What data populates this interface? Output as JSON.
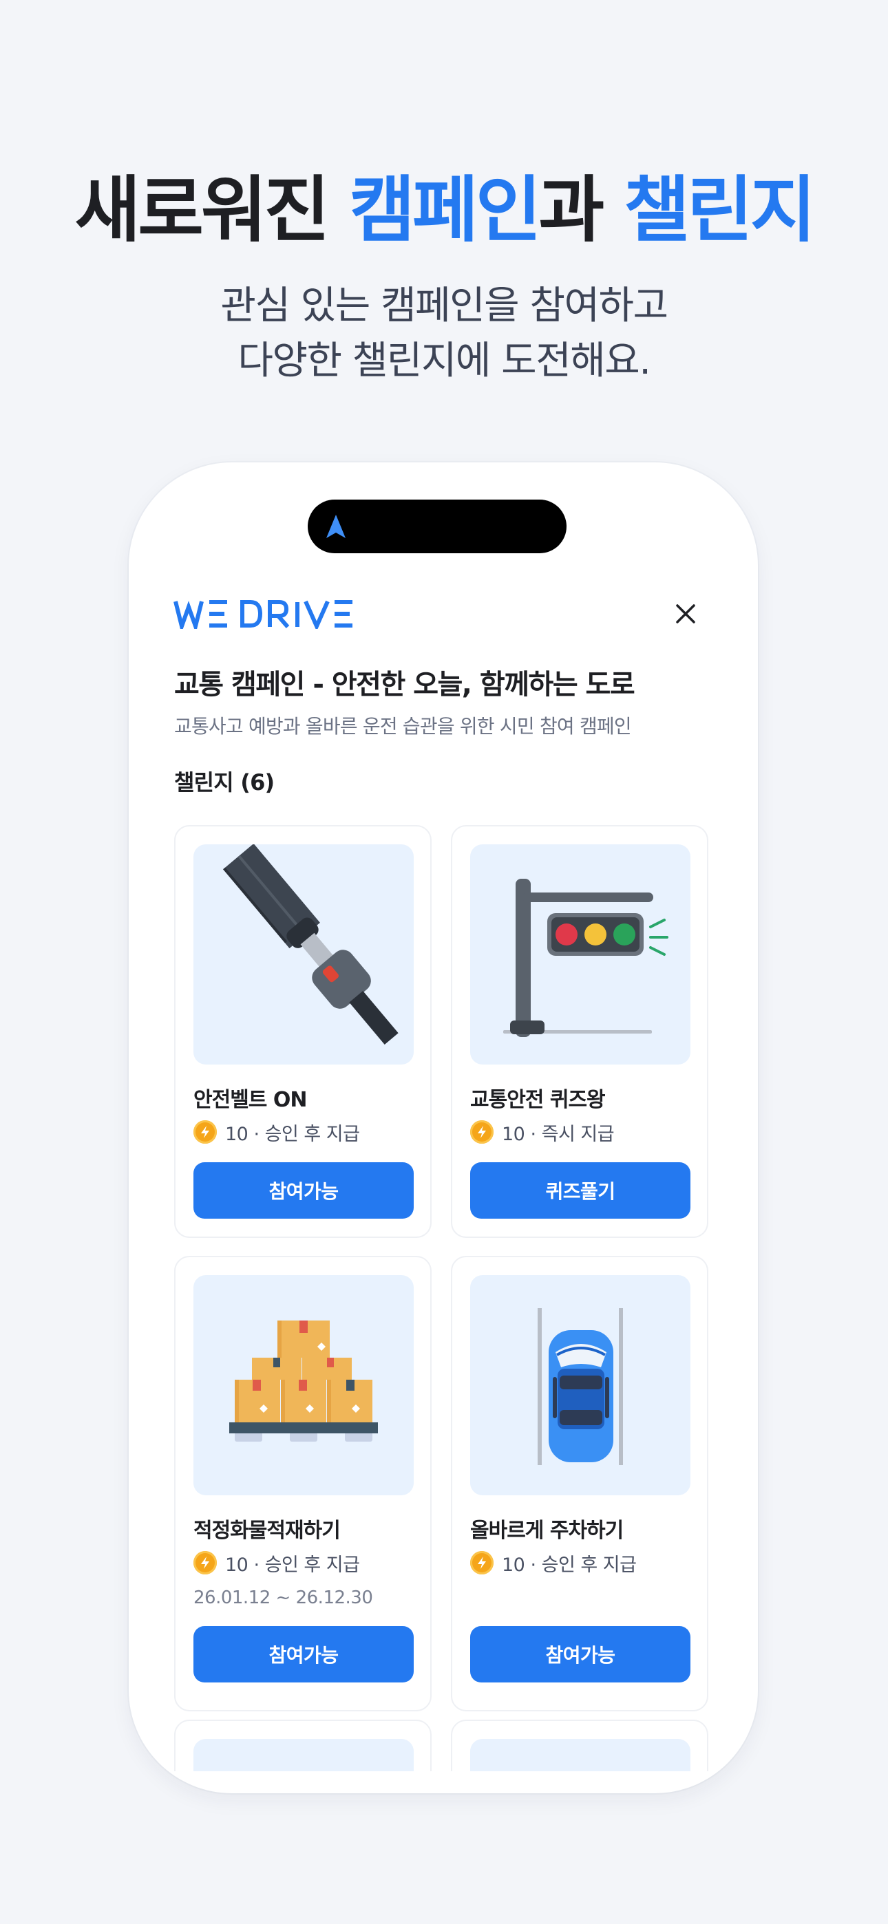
{
  "promo": {
    "headline_part1": "새로워진 ",
    "headline_accent1": "캠페인",
    "headline_part2": "과 ",
    "headline_accent2": "챌린지",
    "subhead_line1": "관심 있는 캠페인을 참여하고",
    "subhead_line2": "다양한 챌린지에 도전해요."
  },
  "app": {
    "logo": "WE DRIVE",
    "close_icon": "close-icon",
    "campaign_title": "교통 캠페인 - 안전한 오늘, 함께하는 도로",
    "campaign_description": "교통사고 예방과 올바른 운전 습관을 위한 시민 참여 캠페인",
    "challenge_section_label": "챌린지 (6)",
    "challenges": [
      {
        "name": "안전벨트 ON",
        "image_icon": "seatbelt-icon",
        "reward": "10 · 승인 후 지급",
        "period": "",
        "button_label": "참여가능"
      },
      {
        "name": "교통안전 퀴즈왕",
        "image_icon": "traffic-light-icon",
        "reward": "10 · 즉시 지급",
        "period": "",
        "button_label": "퀴즈풀기"
      },
      {
        "name": "적정화물적재하기",
        "image_icon": "cargo-boxes-icon",
        "reward": "10 · 승인 후 지급",
        "period": "26.01.12 ~ 26.12.30",
        "button_label": "참여가능"
      },
      {
        "name": "올바르게 주차하기",
        "image_icon": "parked-car-icon",
        "reward": "10 · 승인 후 지급",
        "period": "",
        "button_label": "참여가능"
      }
    ]
  },
  "colors": {
    "accent": "#2479f0",
    "background": "#f3f5f9",
    "thumb_background": "#e8f2fe",
    "coin": "#f5a519"
  }
}
